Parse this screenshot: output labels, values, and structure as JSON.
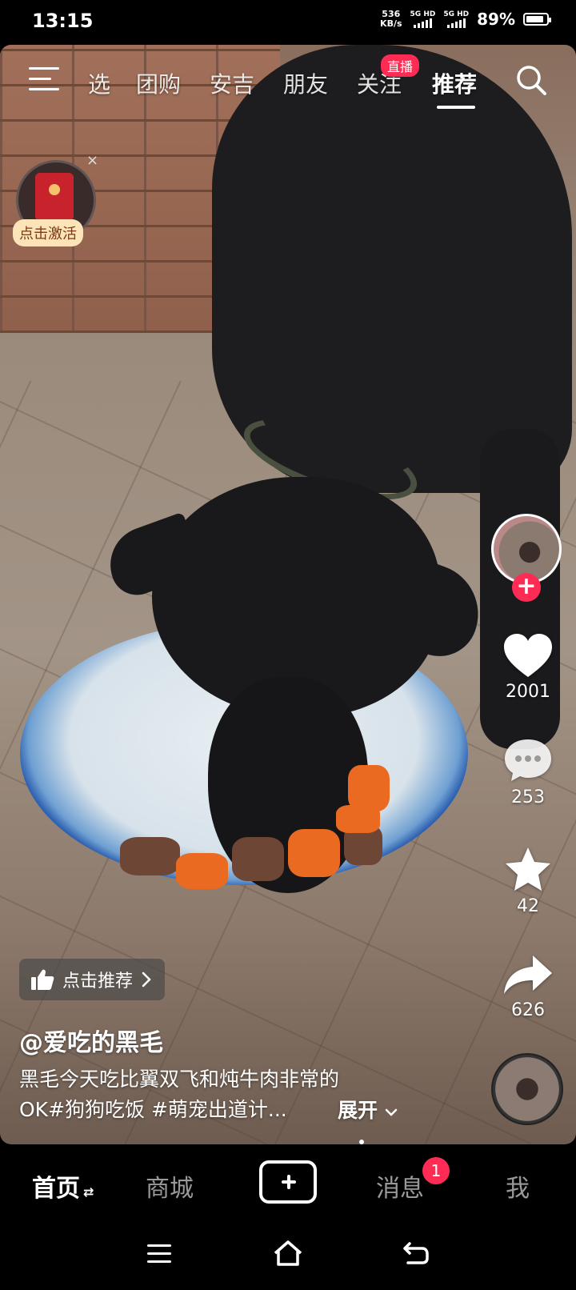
{
  "status_bar": {
    "time": "13:15",
    "net_speed_value": "536",
    "net_speed_unit": "KB/s",
    "sim1": "5G HD",
    "sim2": "5G HD",
    "battery_percent": "89%",
    "battery_level": 0.89
  },
  "top_tabs": {
    "items": [
      {
        "label": "选"
      },
      {
        "label": "团购"
      },
      {
        "label": "安吉"
      },
      {
        "label": "朋友"
      },
      {
        "label": "关注"
      },
      {
        "label": "推荐"
      }
    ],
    "active": "推荐",
    "live_badge": "直播"
  },
  "red_packet": {
    "close": "×",
    "label": "点击激活"
  },
  "actions": {
    "likes": "2001",
    "comments": "253",
    "favorites": "42",
    "shares": "626",
    "follow_symbol": "+"
  },
  "video_info": {
    "recommend_label": "点击推荐",
    "author": "@爱吃的黑毛",
    "caption_line1": "黑毛今天吃比翼双飞和炖牛肉非常的",
    "caption_line2": "OK#狗狗吃饭 #萌宠出道计...",
    "expand": "展开"
  },
  "bottom_nav": {
    "home": "首页",
    "mall": "商城",
    "messages": "消息",
    "messages_badge": "1",
    "me": "我"
  },
  "colors": {
    "accent": "#fe2c55",
    "background": "#000000"
  }
}
